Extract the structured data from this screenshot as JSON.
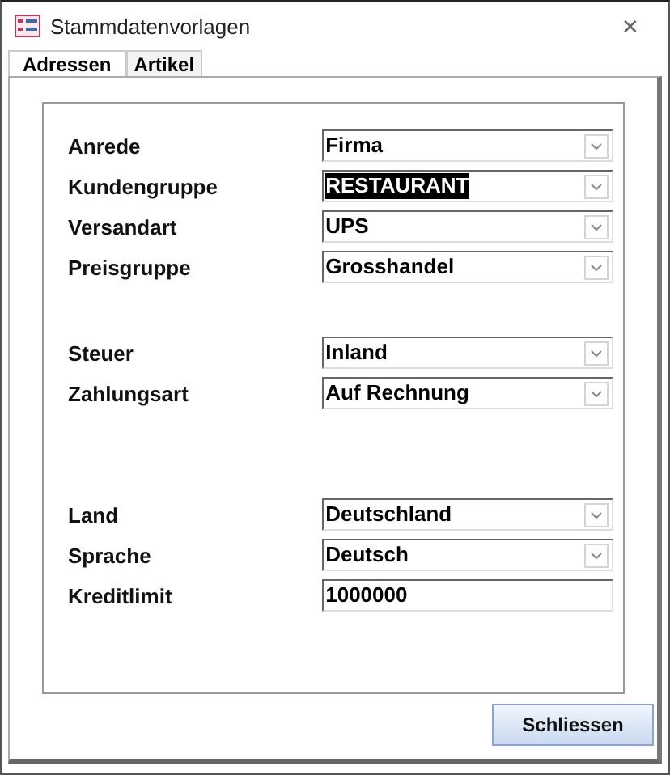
{
  "window": {
    "title": "Stammdatenvorlagen",
    "close": "✕"
  },
  "tabs": [
    {
      "label": "Adressen",
      "selected": true
    },
    {
      "label": "Artikel",
      "selected": false
    }
  ],
  "groups": [
    {
      "fields": [
        {
          "label": "Anrede",
          "kind": "combo",
          "value": "Firma",
          "highlighted": false
        },
        {
          "label": "Kundengruppe",
          "kind": "combo",
          "value": "RESTAURANT",
          "highlighted": true
        },
        {
          "label": "Versandart",
          "kind": "combo",
          "value": "UPS",
          "highlighted": false
        },
        {
          "label": "Preisgruppe",
          "kind": "combo",
          "value": "Grosshandel",
          "highlighted": false
        }
      ]
    },
    {
      "fields": [
        {
          "label": "Steuer",
          "kind": "combo",
          "value": "Inland",
          "highlighted": false
        },
        {
          "label": "Zahlungsart",
          "kind": "combo",
          "value": "Auf Rechnung",
          "highlighted": false
        }
      ]
    },
    {
      "fields": [
        {
          "label": "Land",
          "kind": "combo",
          "value": "Deutschland",
          "highlighted": false
        },
        {
          "label": "Sprache",
          "kind": "combo",
          "value": "Deutsch",
          "highlighted": false
        },
        {
          "label": "Kreditlimit",
          "kind": "text",
          "value": "1000000",
          "highlighted": false
        }
      ]
    }
  ],
  "buttons": [
    "Schliessen"
  ]
}
